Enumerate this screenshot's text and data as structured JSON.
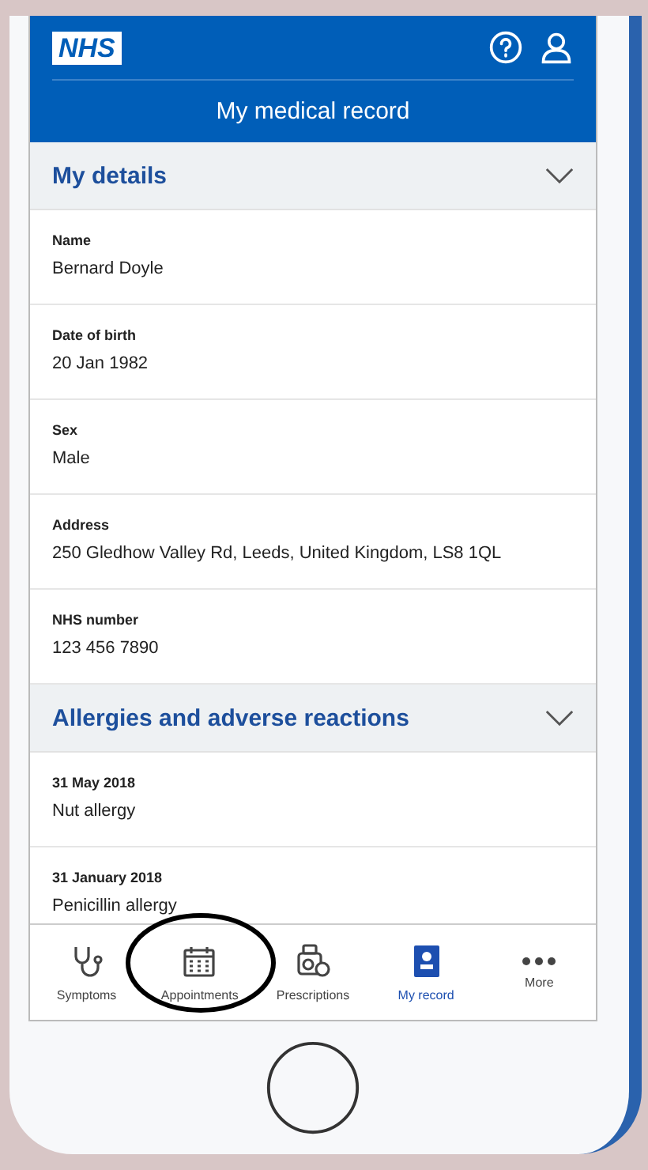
{
  "header": {
    "logo": "NHS",
    "title": "My medical record"
  },
  "sections": [
    {
      "title": "My details",
      "fields": [
        {
          "label": "Name",
          "value": "Bernard Doyle"
        },
        {
          "label": "Date of birth",
          "value": "20 Jan 1982"
        },
        {
          "label": "Sex",
          "value": "Male"
        },
        {
          "label": "Address",
          "value": "250 Gledhow Valley Rd, Leeds, United Kingdom, LS8 1QL"
        },
        {
          "label": "NHS number",
          "value": "123 456 7890"
        }
      ]
    },
    {
      "title": "Allergies and adverse reactions",
      "fields": [
        {
          "label": "31 May 2018",
          "value": "Nut allergy"
        },
        {
          "label": "31 January 2018",
          "value": "Penicillin allergy"
        }
      ]
    }
  ],
  "nav": [
    {
      "kind": "symptoms",
      "label": "Symptoms",
      "selected": false
    },
    {
      "kind": "appointments",
      "label": "Appointments",
      "selected": false
    },
    {
      "kind": "prescriptions",
      "label": "Prescriptions",
      "selected": false
    },
    {
      "kind": "record",
      "label": "My record",
      "selected": true
    },
    {
      "kind": "more",
      "label": "More",
      "selected": false
    }
  ]
}
